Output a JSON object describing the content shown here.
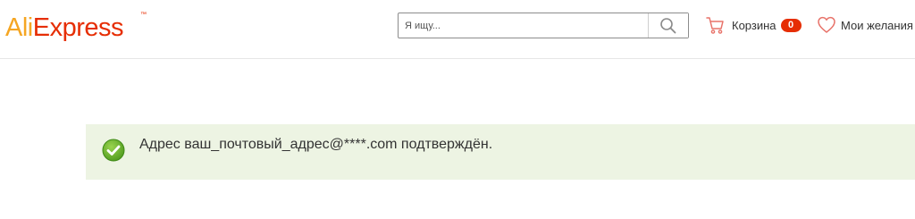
{
  "brand": {
    "logo_part1": "Ali",
    "logo_part2": "Express",
    "trademark": "™"
  },
  "search": {
    "placeholder": "Я ищу...",
    "value": "",
    "button_icon": "search-icon"
  },
  "cart": {
    "label": "Корзина",
    "count": "0",
    "icon": "cart-icon"
  },
  "wishlist": {
    "label": "Мои желания",
    "icon": "heart-icon"
  },
  "notice": {
    "icon": "check-circle-icon",
    "message": "Адрес ваш_почтовый_адрес@****.com подтверждён."
  },
  "colors": {
    "brand_orange": "#f5a623",
    "brand_red": "#e62e04",
    "success_bg": "#edf4e3",
    "success_icon": "#6ab42c"
  }
}
